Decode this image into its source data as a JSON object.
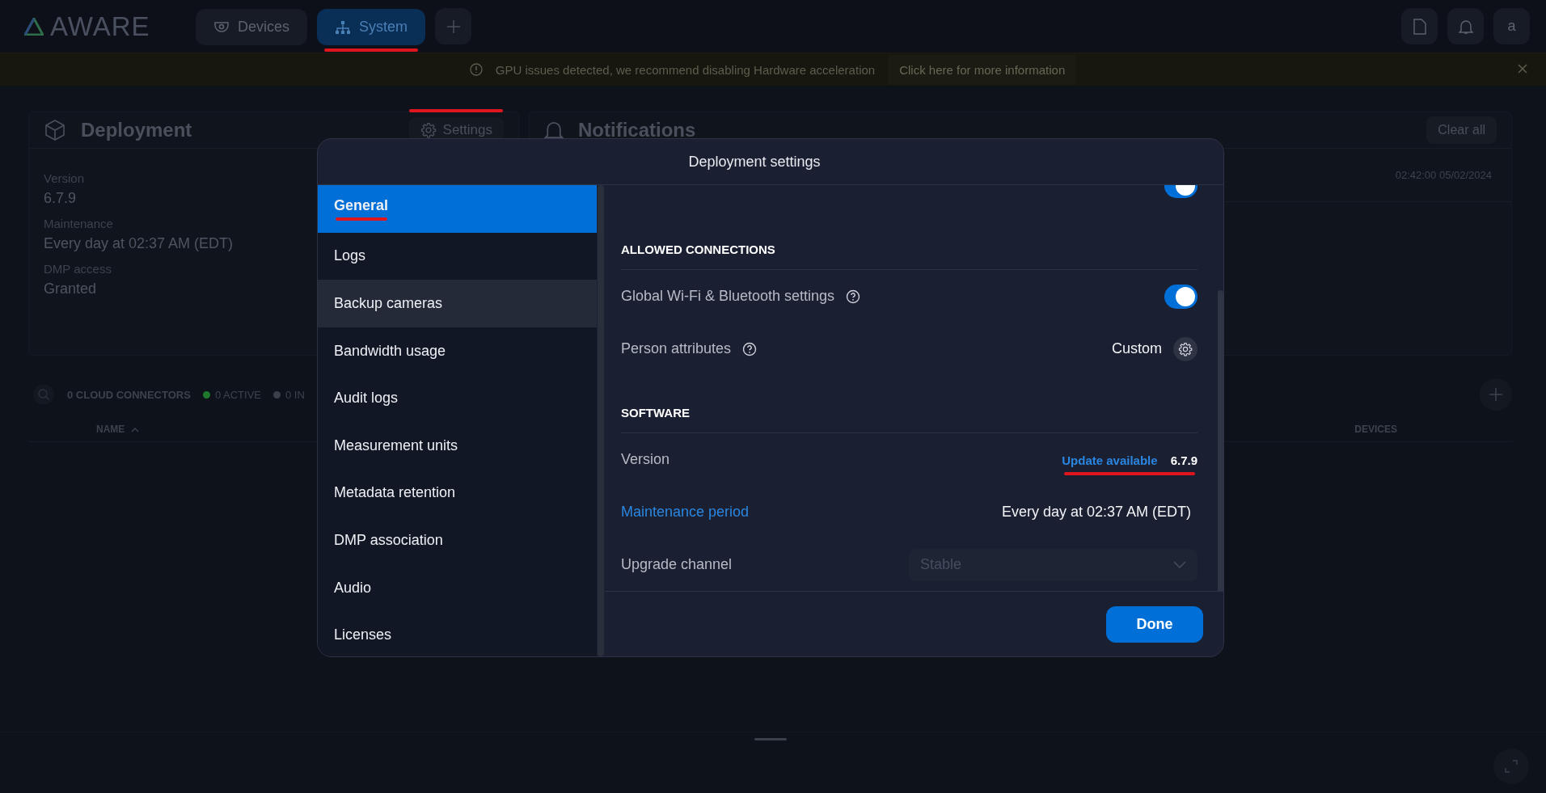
{
  "top_bar": {
    "logo": "AWARE",
    "tabs": [
      {
        "label": "Devices",
        "selected": false
      },
      {
        "label": "System",
        "selected": true
      }
    ],
    "avatar": "a"
  },
  "banner": {
    "message": "GPU issues detected, we recommend disabling Hardware acceleration",
    "link": "Click here for more information"
  },
  "deployment": {
    "title": "Deployment",
    "settings_button": "Settings",
    "fields": [
      {
        "label": "Version",
        "value": "6.7.9"
      },
      {
        "label": "Maintenance",
        "value": "Every day at 02:37 AM (EDT)"
      },
      {
        "label": "DMP access",
        "value": "Granted"
      }
    ]
  },
  "notifications": {
    "title": "Notifications",
    "clear_button": "Clear all",
    "items": [
      {
        "time": "02:42:00 05/02/2024"
      }
    ]
  },
  "connectors": {
    "count": "0 CLOUD CONNECTORS",
    "statuses": [
      {
        "label": "0 ACTIVE",
        "color": "#1f7a2e"
      },
      {
        "label": "0 IN",
        "color": "#3a3f4a"
      }
    ],
    "columns": [
      "NAME",
      "DEVICES"
    ]
  },
  "dialog": {
    "title": "Deployment settings",
    "nav": [
      {
        "label": "General",
        "selected": true
      },
      {
        "label": "Logs",
        "selected": false
      },
      {
        "label": "Backup cameras",
        "selected": false,
        "hovered": true
      },
      {
        "label": "Bandwidth usage",
        "selected": false
      },
      {
        "label": "Audit logs",
        "selected": false
      },
      {
        "label": "Measurement units",
        "selected": false
      },
      {
        "label": "Metadata retention",
        "selected": false
      },
      {
        "label": "DMP association",
        "selected": false
      },
      {
        "label": "Audio",
        "selected": false
      },
      {
        "label": "Licenses",
        "selected": false
      }
    ],
    "sections": [
      {
        "rows": [
          {
            "kind": "toggle",
            "on": true
          }
        ]
      },
      {
        "title": "ALLOWED CONNECTIONS",
        "rows": [
          {
            "kind": "toggle",
            "label": "Global Wi-Fi & Bluetooth settings",
            "help": true,
            "on": true
          },
          {
            "kind": "custom",
            "label": "Person attributes",
            "help": true,
            "value": "Custom"
          }
        ]
      },
      {
        "title": "SOFTWARE",
        "rows": [
          {
            "kind": "version",
            "label": "Version",
            "link": "Update available",
            "value": "6.7.9"
          },
          {
            "kind": "link",
            "label": "Maintenance period",
            "value": "Every day at 02:37 AM (EDT)"
          },
          {
            "kind": "select",
            "label": "Upgrade channel",
            "value": "Stable",
            "disabled": true
          }
        ]
      }
    ],
    "done_button": "Done"
  }
}
